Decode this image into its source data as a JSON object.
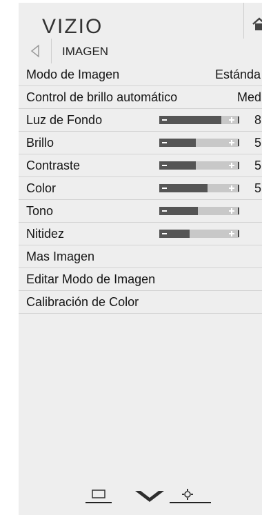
{
  "header": {
    "logo": "VIZIO",
    "icons": [
      "home-icon"
    ]
  },
  "breadcrumb": {
    "label": "IMAGEN",
    "icons": [
      "back-arrow-icon"
    ]
  },
  "menu": [
    {
      "label": "Modo de Imagen",
      "value": "Estánda"
    },
    {
      "label": "Control de brillo automático",
      "value": "Medi"
    },
    {
      "label": "Luz de Fondo",
      "value": "8",
      "level": 0.78
    },
    {
      "label": "Brillo",
      "value": "5",
      "level": 0.46
    },
    {
      "label": "Contraste",
      "value": "5",
      "level": 0.46
    },
    {
      "label": "Color",
      "value": "5",
      "level": 0.6
    },
    {
      "label": "Tono",
      "value": "",
      "level": 0.48
    },
    {
      "label": "Nitidez",
      "value": "",
      "level": 0.38
    },
    {
      "label": "Mas Imagen",
      "value": ""
    },
    {
      "label": "Editar Modo de Imagen",
      "value": ""
    },
    {
      "label": "Calibración de Color",
      "value": ""
    }
  ],
  "footer": {
    "icons": [
      "input-icon",
      "vizio-v-icon",
      "settings-gear-icon"
    ]
  }
}
